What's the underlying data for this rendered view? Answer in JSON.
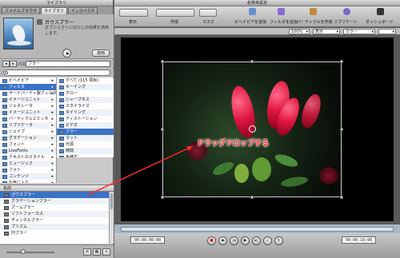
{
  "library": {
    "window_title": "ライブラリ",
    "tabs": [
      "ファイルブラウザ",
      "ライブラリ",
      "インスペクタ"
    ],
    "active_tab": 1,
    "preview": {
      "name": "ガウスブラー",
      "description": "オブジェクトにぼかしの効果を適用します。",
      "apply_label": "適用"
    },
    "path_label": "パス:",
    "path_value": "ブラー",
    "search_placeholder": "",
    "categories": [
      {
        "label": "ビヘイビア",
        "sel": false
      },
      {
        "label": "フィルタ",
        "sel": true
      },
      {
        "label": "サードパーティ製フィルタ",
        "sel": false
      },
      {
        "label": "イメージユニット",
        "sel": false
      },
      {
        "label": "ジェネレータ",
        "sel": false
      },
      {
        "label": "イメージユニット",
        "sel": false
      },
      {
        "label": "パーティクルエミッタ",
        "sel": false
      },
      {
        "label": "リプリケータ",
        "sel": false
      },
      {
        "label": "シェイプ",
        "sel": false
      },
      {
        "label": "グラデーション",
        "sel": false
      },
      {
        "label": "フォント",
        "sel": false
      },
      {
        "label": "LiveFonts",
        "sel": false
      },
      {
        "label": "テキストのスタイル",
        "sel": false
      },
      {
        "label": "ミュージック",
        "sel": false
      },
      {
        "label": "フォト",
        "sel": false
      },
      {
        "label": "コンテンツ",
        "sel": false
      },
      {
        "label": "お気に入り",
        "sel": false
      }
    ],
    "subcategories": [
      {
        "label": "すべて (115 項目)",
        "sel": false
      },
      {
        "label": "キーイング",
        "sel": false
      },
      {
        "label": "グロー",
        "sel": false
      },
      {
        "label": "シャープネス",
        "sel": false
      },
      {
        "label": "スタイライズ",
        "sel": false
      },
      {
        "label": "タイリング",
        "sel": false
      },
      {
        "label": "ディストーション",
        "sel": false
      },
      {
        "label": "ビデオ",
        "sel": false
      },
      {
        "label": "ブラー",
        "sel": true
      },
      {
        "label": "マット",
        "sel": false
      },
      {
        "label": "光源",
        "sel": false
      },
      {
        "label": "時間",
        "sel": false
      },
      {
        "label": "色補正",
        "sel": false
      }
    ],
    "list_header": "名前",
    "items": [
      {
        "label": "ガウスブラー",
        "sel": true
      },
      {
        "label": "グラデーションブラー",
        "sel": false
      },
      {
        "label": "ズームブラー",
        "sel": false
      },
      {
        "label": "ソフトフォーカス",
        "sel": false
      },
      {
        "label": "チャンネルブラー",
        "sel": false
      },
      {
        "label": "プリズム",
        "sel": false
      },
      {
        "label": "円ブラー",
        "sel": false
      }
    ]
  },
  "canvas_window": {
    "title": "名称未設定",
    "toolbar": {
      "display_label": "表示",
      "create_label": "作成",
      "mask_label": "マスク",
      "add_behavior_label": "ビヘイビアを追加",
      "add_filter_label": "フィルタを追加",
      "make_particles_label": "パーティクルを作成",
      "replicate_label": "リプリケート",
      "dashboard_label": "ダッシュボード"
    },
    "zoom": "100%",
    "view_select": "表示",
    "color_select": "カラー",
    "overlay_annotation": "ドラッグドロップする",
    "timecode_start": "00:00:00;00",
    "timecode_end": "00:00:10;00",
    "annotation_color": "#ff2a2a"
  }
}
